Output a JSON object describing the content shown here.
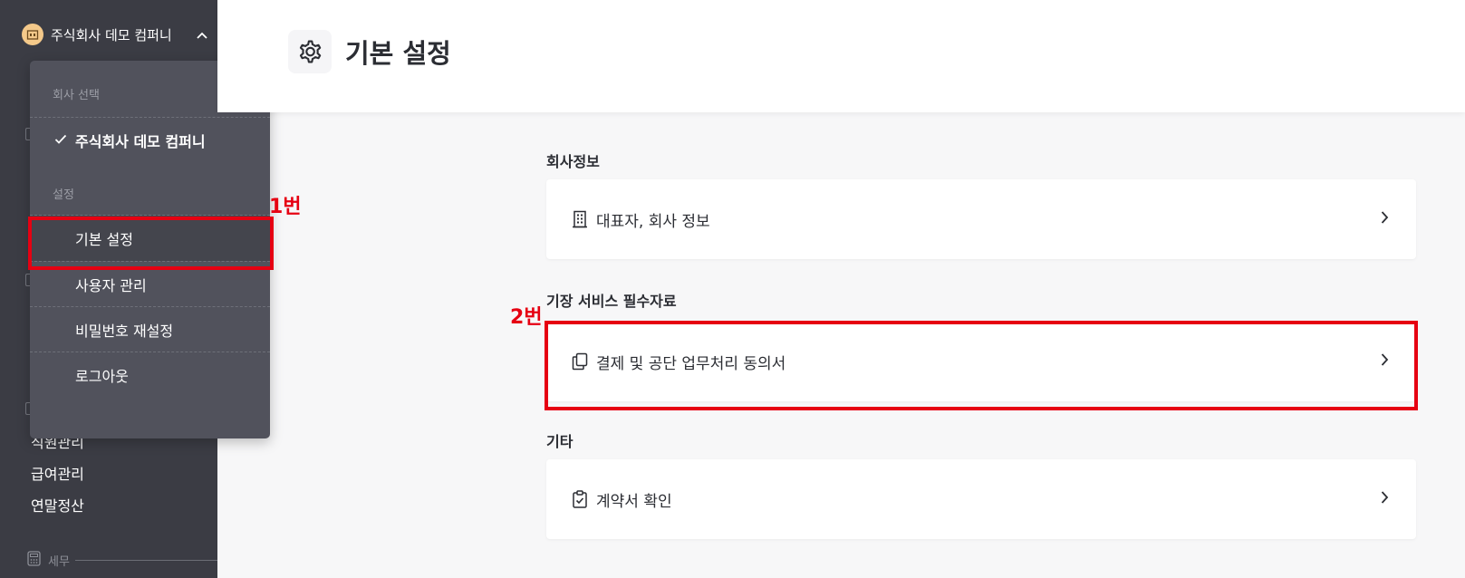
{
  "sidebar": {
    "company_name": "주식회사 데모 컴퍼니",
    "nav_items": [
      "직원관리",
      "급여관리",
      "연말정산"
    ],
    "section_label": "세무"
  },
  "dropdown": {
    "company_section_label": "회사 선택",
    "selected_company": "주식회사 데모 컴퍼니",
    "settings_section_label": "설정",
    "items": [
      "기본 설정",
      "사용자 관리",
      "비밀번호 재설정",
      "로그아웃"
    ]
  },
  "annotations": {
    "label_1": "1번",
    "label_2": "2번",
    "color": "#e60012"
  },
  "header": {
    "title": "기본 설정",
    "icon": "gear-icon"
  },
  "sections": [
    {
      "title": "회사정보",
      "card": {
        "label": "대표자, 회사 정보",
        "icon": "building-icon"
      }
    },
    {
      "title": "기장 서비스 필수자료",
      "card": {
        "label": "결제 및 공단 업무처리 동의서",
        "icon": "copy-document-icon"
      }
    },
    {
      "title": "기타",
      "card": {
        "label": "계약서 확인",
        "icon": "clipboard-check-icon"
      }
    }
  ],
  "colors": {
    "sidebar_bg": "#3b3c44",
    "dropdown_bg": "#51525c",
    "page_bg": "#f7f7f8",
    "card_bg": "#ffffff"
  }
}
